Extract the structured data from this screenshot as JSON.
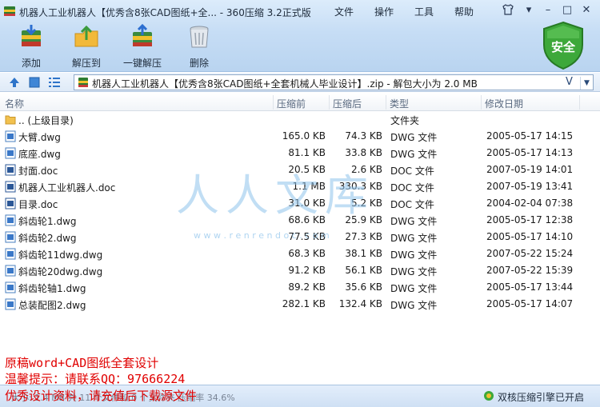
{
  "titlebar": {
    "title": "机器人工业机器人【优秀含8张CAD图纸+全... - 360压缩 3.2正式版",
    "menu": [
      "文件",
      "操作",
      "工具",
      "帮助"
    ]
  },
  "toolbar": {
    "add": "添加",
    "extract_to": "解压到",
    "one_click_extract": "一键解压",
    "delete": "删除",
    "security_badge": "安全"
  },
  "address": {
    "path": "机器人工业机器人【优秀含8张CAD图纸+全套机械人毕业设计】.zip - 解包大小为 2.0 MB",
    "v_label": "V"
  },
  "columns": {
    "name": "名称",
    "size": "压缩前",
    "compressed": "压缩后",
    "type": "类型",
    "modified": "修改日期"
  },
  "files": [
    {
      "name": ".. (上级目录)",
      "size": "",
      "compressed": "",
      "type": "文件夹",
      "date": "",
      "icon": "folder-icon"
    },
    {
      "name": "大臂.dwg",
      "size": "165.0 KB",
      "compressed": "74.3 KB",
      "type": "DWG 文件",
      "date": "2005-05-17 14:15",
      "icon": "dwg-file-icon"
    },
    {
      "name": "底座.dwg",
      "size": "81.1 KB",
      "compressed": "33.8 KB",
      "type": "DWG 文件",
      "date": "2005-05-17 14:13",
      "icon": "dwg-file-icon"
    },
    {
      "name": "封面.doc",
      "size": "20.5 KB",
      "compressed": "2.6 KB",
      "type": "DOC 文件",
      "date": "2007-05-19 14:01",
      "icon": "doc-file-icon"
    },
    {
      "name": "机器人工业机器人.doc",
      "size": "1.1 MB",
      "compressed": "330.3 KB",
      "type": "DOC 文件",
      "date": "2007-05-19 13:41",
      "icon": "doc-file-icon"
    },
    {
      "name": "目录.doc",
      "size": "31.0 KB",
      "compressed": "5.2 KB",
      "type": "DOC 文件",
      "date": "2004-02-04 07:38",
      "icon": "doc-file-icon"
    },
    {
      "name": "斜齿轮1.dwg",
      "size": "68.6 KB",
      "compressed": "25.9 KB",
      "type": "DWG 文件",
      "date": "2005-05-17 12:38",
      "icon": "dwg-file-icon"
    },
    {
      "name": "斜齿轮2.dwg",
      "size": "77.5 KB",
      "compressed": "27.3 KB",
      "type": "DWG 文件",
      "date": "2005-05-17 14:10",
      "icon": "dwg-file-icon"
    },
    {
      "name": "斜齿轮11dwg.dwg",
      "size": "68.3 KB",
      "compressed": "38.1 KB",
      "type": "DWG 文件",
      "date": "2007-05-22 15:24",
      "icon": "dwg-file-icon"
    },
    {
      "name": "斜齿轮20dwg.dwg",
      "size": "91.2 KB",
      "compressed": "56.1 KB",
      "type": "DWG 文件",
      "date": "2007-05-22 15:39",
      "icon": "dwg-file-icon"
    },
    {
      "name": "斜齿轮轴1.dwg",
      "size": "89.2 KB",
      "compressed": "35.6 KB",
      "type": "DWG 文件",
      "date": "2005-05-17 13:44",
      "icon": "dwg-file-icon"
    },
    {
      "name": "总装配图2.dwg",
      "size": "282.1 KB",
      "compressed": "132.4 KB",
      "type": "DWG 文件",
      "date": "2005-05-17 14:07",
      "icon": "dwg-file-icon"
    }
  ],
  "watermark": {
    "text": "人人文库",
    "url": "w w w . r e n r e n d o c . c o m"
  },
  "overlay": {
    "line1": "原稿word+CAD图纸全套设计",
    "line2": "温馨提示：请联系QQ：97666224",
    "line3": "优秀设计资料，请充值后下载源文件"
  },
  "status": {
    "left": "大小: 1.4 MB 共 11 个文件和 0 个文件夹 压缩率 34.6%",
    "right": "双核压缩引擎已开启"
  }
}
